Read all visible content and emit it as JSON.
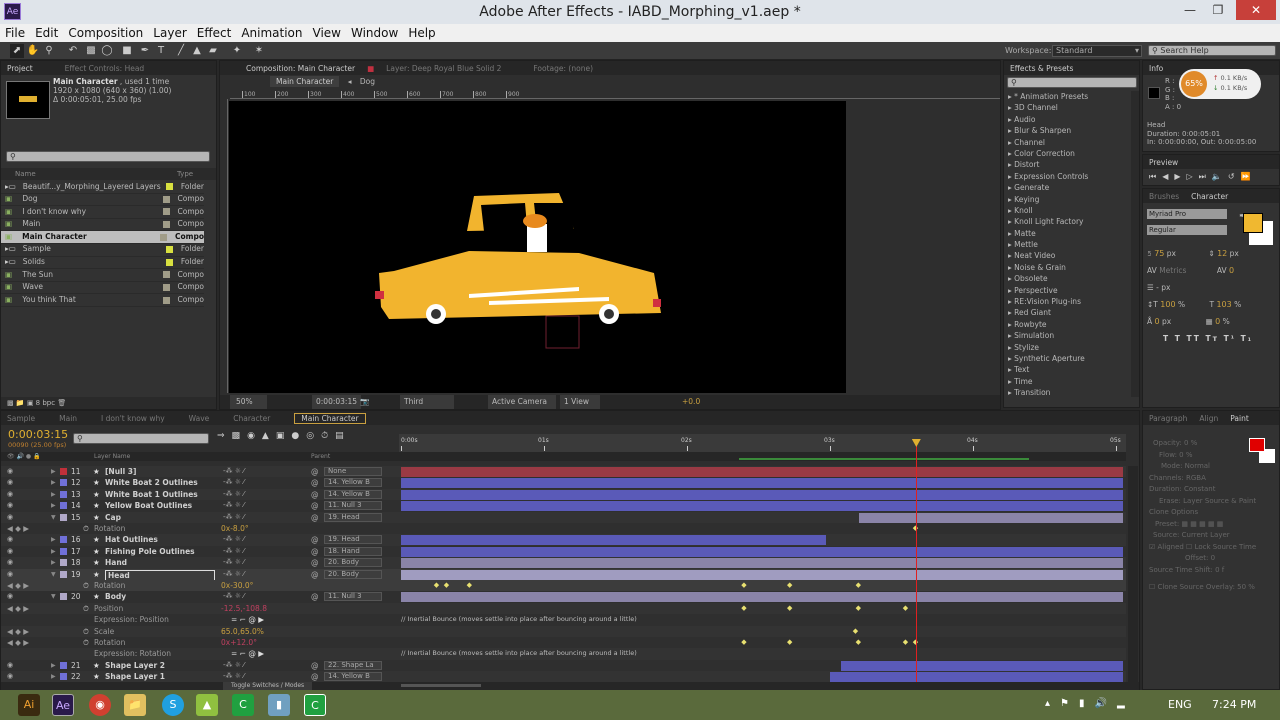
{
  "window": {
    "title": "Adobe After Effects - IABD_Morphing_v1.aep *",
    "logo": "Ae",
    "controls": [
      "minimize-icon",
      "maximize-icon",
      "close-icon"
    ]
  },
  "menu": [
    "File",
    "Edit",
    "Composition",
    "Layer",
    "Effect",
    "Animation",
    "View",
    "Window",
    "Help"
  ],
  "toolbar": {
    "workspace_label": "Workspace:",
    "workspace_value": "Standard",
    "search_help": "Search Help"
  },
  "project": {
    "tab": "Project",
    "tab2": "Effect Controls: Head",
    "item_name": "Main Character",
    "item_used": ", used 1 time",
    "item_dims": "1920 x 1080  (640 x 360) (1.00)",
    "item_duration": "Δ 0:00:05:01, 25.00 fps",
    "col_name": "Name",
    "col_type": "Type",
    "bpc": "8 bpc",
    "items": [
      {
        "name": "Beautif...y_Morphing_Layered Layers",
        "type": "Folder",
        "kind": "folder",
        "color": "#d8e040"
      },
      {
        "name": "Dog",
        "type": "Compo",
        "kind": "comp",
        "color": "#a09c88"
      },
      {
        "name": "I don't know why",
        "type": "Compo",
        "kind": "comp",
        "color": "#a09c88"
      },
      {
        "name": "Main",
        "type": "Compo",
        "kind": "comp",
        "color": "#a09c88"
      },
      {
        "name": "Main Character",
        "type": "Compo",
        "kind": "comp",
        "color": "#a09c88",
        "selected": true
      },
      {
        "name": "Sample",
        "type": "Folder",
        "kind": "folder",
        "color": "#d8e040"
      },
      {
        "name": "Solids",
        "type": "Folder",
        "kind": "folder",
        "color": "#d8e040"
      },
      {
        "name": "The Sun",
        "type": "Compo",
        "kind": "comp",
        "color": "#a09c88"
      },
      {
        "name": "Wave",
        "type": "Compo",
        "kind": "comp",
        "color": "#a09c88"
      },
      {
        "name": "You think That",
        "type": "Compo",
        "kind": "comp",
        "color": "#a09c88"
      }
    ]
  },
  "composition": {
    "tab": "Composition: Main Character",
    "tab_layer": "Layer: Deep Royal Blue Solid 2",
    "tab_footage": "Footage: (none)",
    "breadcrumb": [
      "Main Character",
      "Dog"
    ],
    "ruler": [
      "100",
      "200",
      "300",
      "400",
      "500",
      "600",
      "700",
      "800",
      "900"
    ],
    "zoom": "50%",
    "timecode": "0:00:03:15",
    "resolution": "Third",
    "camera": "Active Camera",
    "views": "1 View",
    "exposure": "+0.0"
  },
  "effects": {
    "tab": "Effects & Presets",
    "items": [
      "* Animation Presets",
      "3D Channel",
      "Audio",
      "Blur & Sharpen",
      "Channel",
      "Color Correction",
      "Distort",
      "Expression Controls",
      "Generate",
      "Keying",
      "Knoll",
      "Knoll Light Factory",
      "Matte",
      "Mettle",
      "Neat Video",
      "Noise & Grain",
      "Obsolete",
      "Perspective",
      "RE:Vision Plug-ins",
      "Red Giant",
      "Rowbyte",
      "Simulation",
      "Stylize",
      "Synthetic Aperture",
      "Text",
      "Time",
      "Transition"
    ]
  },
  "info": {
    "tab": "Info",
    "r": "R :",
    "g": "G :",
    "b": "B :",
    "a": "A : 0",
    "cpu": "65%",
    "up": "0.1 KB/s",
    "down": "0.1 KB/s",
    "layer": "Head",
    "duration": "Duration: 0:00:05:01",
    "inout": "In: 0:00:00:00, Out: 0:00:05:00"
  },
  "preview": {
    "tab": "Preview"
  },
  "character": {
    "tab_brushes": "Brushes",
    "tab": "Character",
    "font": "Myriad Pro",
    "style": "Regular",
    "size": "75",
    "size_unit": "px",
    "leading": "12",
    "leading_unit": "px",
    "kerning": "Metrics",
    "tracking": "0",
    "stroke": "- px",
    "vscale": "100",
    "vscale_unit": "%",
    "hscale": "103",
    "hscale_unit": "%",
    "baseline": "0",
    "baseline_unit": "px",
    "tsume": "0",
    "tsume_unit": "%",
    "fill_color": "#f0b830",
    "styles": [
      "T",
      "T",
      "TT",
      "Tт",
      "T¹",
      "T₁"
    ]
  },
  "paint": {
    "tabs": [
      "Paragraph",
      "Align",
      "Paint"
    ],
    "opacity": "Opacity: 0 %",
    "flow": "Flow: 0 %",
    "mode": "Mode:",
    "mode_val": "Normal",
    "channels": "Channels:",
    "channels_val": "RGBA",
    "duration": "Duration:",
    "duration_val": "Constant",
    "erase": "Erase:",
    "erase_val": "Layer Source & Paint",
    "clone": "Clone Options",
    "preset": "Preset:",
    "source": "Source:",
    "source_val": "Current Layer",
    "aligned": "Aligned",
    "lock": "Lock Source Time",
    "offset": "Offset: 0",
    "shift": "Source Time Shift: 0 f",
    "overlay": "Clone Source Overlay: 50 %",
    "fg": "#e00000"
  },
  "timeline": {
    "tabs": [
      "Sample",
      "Main",
      "I don't know why",
      "Wave",
      "Character",
      "Main Character"
    ],
    "timecode": "0:00:03:15",
    "frames": "00090 (25.00 fps)",
    "col_layer": "Layer Name",
    "col_parent": "Parent",
    "ruler": [
      "0:00s",
      "01s",
      "02s",
      "03s",
      "04s",
      "05s"
    ],
    "current_time_s": 3.6,
    "toggle": "Toggle Switches / Modes",
    "rows": [
      {
        "type": "layer",
        "num": "11",
        "name": "[Null 3]",
        "label": "#c0303a",
        "parent": "None",
        "in": 0,
        "out": 5.05,
        "bar": "#9a3a44"
      },
      {
        "type": "layer",
        "num": "12",
        "name": "White Boat 2 Outlines",
        "label": "#7070d8",
        "parent": "14. Yellow B",
        "in": 0,
        "out": 5.05,
        "bar": "#5a5ab8"
      },
      {
        "type": "layer",
        "num": "13",
        "name": "White Boat 1 Outlines",
        "label": "#7070d8",
        "parent": "14. Yellow B",
        "in": 0,
        "out": 5.05,
        "bar": "#5a5ab8"
      },
      {
        "type": "layer",
        "num": "14",
        "name": "Yellow Boat Outlines",
        "label": "#7070d8",
        "parent": "11. Null 3",
        "in": 0,
        "out": 5.05,
        "bar": "#5a5ab8"
      },
      {
        "type": "layer",
        "num": "15",
        "name": "Cap",
        "label": "#b0a8c8",
        "parent": "19. Head",
        "in": 3.2,
        "out": 5.05,
        "bar": "#8a84a8",
        "open": true
      },
      {
        "type": "prop",
        "name": "Rotation",
        "value": "0x-8.0°",
        "vcolor": "#c9a040",
        "kf": [
          3.6
        ]
      },
      {
        "type": "layer",
        "num": "16",
        "name": "Hat Outlines",
        "label": "#7070d8",
        "parent": "19. Head",
        "in": 0,
        "out": 2.97,
        "bar": "#5a5ab8"
      },
      {
        "type": "layer",
        "num": "17",
        "name": "Fishing Pole Outlines",
        "label": "#7070d8",
        "parent": "18. Hand",
        "in": 0,
        "out": 5.05,
        "bar": "#5a5ab8"
      },
      {
        "type": "layer",
        "num": "18",
        "name": "Hand",
        "label": "#b0a8c8",
        "parent": "20. Body",
        "in": 0,
        "out": 5.05,
        "bar": "#8a84a8"
      },
      {
        "type": "layer",
        "num": "19",
        "name": "Head",
        "label": "#b0a8c8",
        "parent": "20. Body",
        "in": 0,
        "out": 5.05,
        "bar": "#a09cc0",
        "open": true,
        "selected": true
      },
      {
        "type": "prop",
        "name": "Rotation",
        "value": "0x-30.0°",
        "vcolor": "#c9a040",
        "kf": [
          0.25,
          0.32,
          0.48,
          2.4,
          2.72,
          3.2
        ],
        "selected": true
      },
      {
        "type": "layer",
        "num": "20",
        "name": "Body",
        "label": "#b0a8c8",
        "parent": "11. Null 3",
        "in": 0,
        "out": 5.05,
        "bar": "#8a84a8",
        "open": true
      },
      {
        "type": "prop",
        "name": "Position",
        "value": "-12.5,-108.8",
        "vcolor": "#c04060",
        "kf": [
          2.4,
          2.72,
          3.2,
          3.53
        ]
      },
      {
        "type": "expr",
        "name": "Expression: Position",
        "text": "// Inertial Bounce (moves settle into place after bouncing around a little)"
      },
      {
        "type": "prop",
        "name": "Scale",
        "value": "65.0,65.0%",
        "vcolor": "#c9a040",
        "kf": [
          3.18
        ]
      },
      {
        "type": "prop",
        "name": "Rotation",
        "value": "0x+12.0°",
        "vcolor": "#c04060",
        "kf": [
          2.4,
          2.72,
          3.2,
          3.53,
          3.6
        ]
      },
      {
        "type": "expr",
        "name": "Expression: Rotation",
        "text": "// Inertial Bounce (moves settle into place after bouncing around a little)"
      },
      {
        "type": "layer",
        "num": "21",
        "name": "Shape Layer 2",
        "label": "#7070d8",
        "parent": "22. Shape La",
        "in": 3.08,
        "out": 5.05,
        "bar": "#5a5ab8"
      },
      {
        "type": "layer",
        "num": "22",
        "name": "Shape Layer 1",
        "label": "#7070d8",
        "parent": "14. Yellow B",
        "in": 3.0,
        "out": 5.05,
        "bar": "#5a5ab8"
      }
    ]
  },
  "taskbar": {
    "apps": [
      "Ai",
      "Ae",
      "Chrome",
      "Explorer",
      "Android",
      "Skype",
      "Camtasia",
      "Files",
      "Camtasia Recorder"
    ],
    "lang": "ENG",
    "time": "7:24 PM"
  }
}
